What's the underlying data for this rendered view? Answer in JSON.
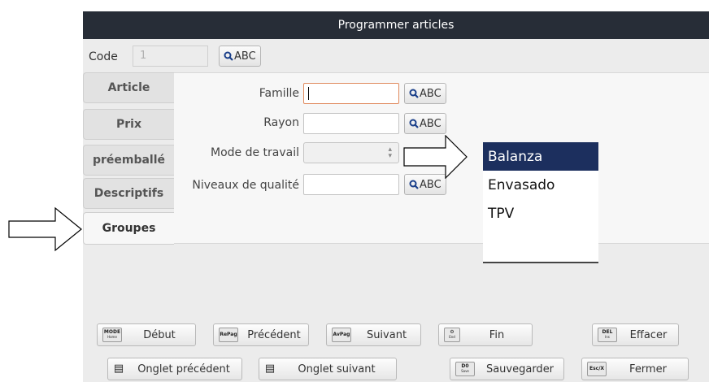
{
  "window": {
    "title": "Programmer articles"
  },
  "code": {
    "label": "Code",
    "value": "1",
    "search_label": "ABC"
  },
  "tabs": [
    {
      "label": "Article"
    },
    {
      "label": "Prix"
    },
    {
      "label": "préemballé"
    },
    {
      "label": "Descriptifs"
    },
    {
      "label": "Groupes",
      "active": true
    }
  ],
  "fields": {
    "famille": {
      "label": "Famille",
      "value": "",
      "search_label": "ABC"
    },
    "rayon": {
      "label": "Rayon",
      "value": "",
      "search_label": "ABC"
    },
    "mode_travail": {
      "label": "Mode de travail",
      "value": ""
    },
    "niveaux_qualite": {
      "label": "Niveaux de qualité",
      "value": "",
      "search_label": "ABC"
    }
  },
  "mode_travail_options": [
    {
      "label": "Balanza",
      "selected": true
    },
    {
      "label": "Envasado"
    },
    {
      "label": "TPV"
    }
  ],
  "buttons": {
    "debut": {
      "key": "MODE",
      "key_sub": "Home",
      "label": "Début"
    },
    "precedent": {
      "key": "RePag",
      "label": "Précédent"
    },
    "suivant": {
      "key": "AvPag",
      "label": "Suivant"
    },
    "fin": {
      "key": "End",
      "label": "Fin"
    },
    "effacer": {
      "key": "DEL",
      "key_sub": "Ins",
      "label": "Effacer"
    },
    "onglet_precedent": {
      "label": "Onglet précédent"
    },
    "onglet_suivant": {
      "label": "Onglet suivant"
    },
    "sauvegarder": {
      "key": "D0",
      "key_sub": "Save",
      "label": "Sauvegarder"
    },
    "fermer": {
      "key": "Esc/X",
      "label": "Fermer"
    }
  },
  "colors": {
    "titlebar": "#272d37",
    "selection": "#1c2f5e",
    "focus_border": "#e08a5e"
  }
}
